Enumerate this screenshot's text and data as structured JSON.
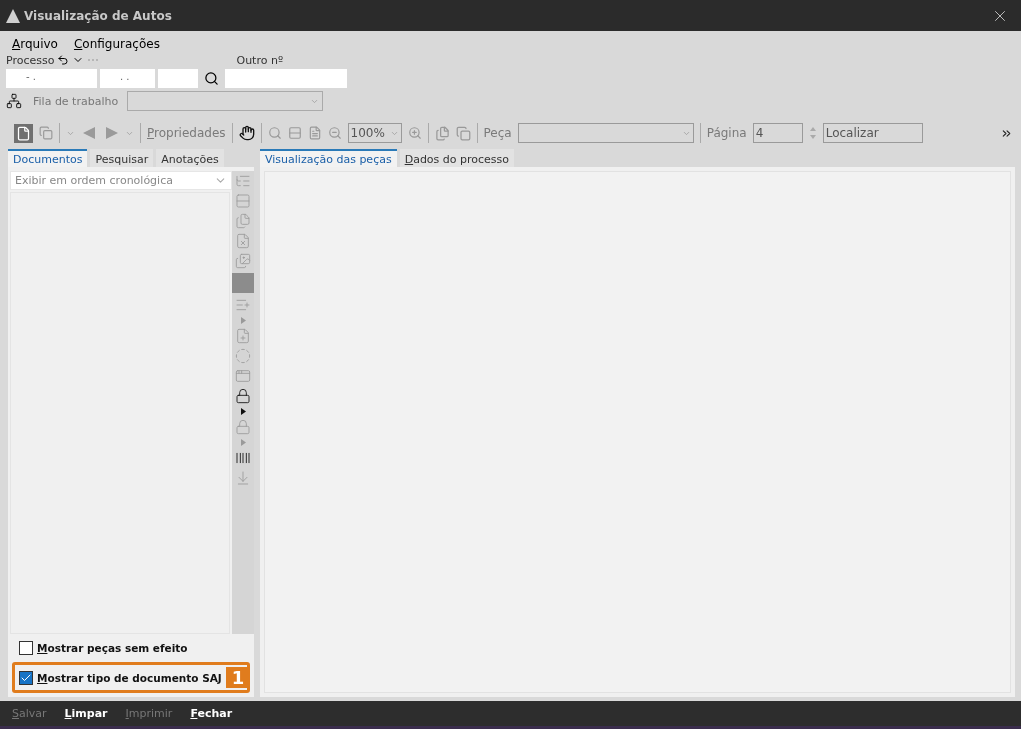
{
  "window": {
    "title": "Visualização de Autos"
  },
  "menu": [
    {
      "label": "Arquivo"
    },
    {
      "label": "Configurações"
    }
  ],
  "processo": {
    "label": "Processo",
    "segments": [
      {
        "kind": "mask",
        "value": "- ."
      },
      {
        "kind": "mask",
        "value": ". ."
      },
      {
        "kind": "blank"
      }
    ],
    "other_label": "Outro nº"
  },
  "fila": {
    "label": "Fila de trabalho",
    "disabled": true
  },
  "toolbar": {
    "properties": "Propriedades",
    "zoom": "100%",
    "peca_label": "Peça",
    "pagina_label": "Página",
    "pagina": "4",
    "localizar": "Localizar"
  },
  "left_tabs": [
    {
      "label": "Documentos",
      "selected": true
    },
    {
      "label": "Pesquisar",
      "selected": false
    },
    {
      "label": "Anotações",
      "selected": false
    }
  ],
  "order": {
    "placeholder": "Exibir em ordem cronológica"
  },
  "side_tools": [
    {
      "kind": "tree",
      "disabled": true
    },
    {
      "kind": "panel",
      "disabled": true
    },
    {
      "kind": "files",
      "disabled": true
    },
    {
      "kind": "filex",
      "disabled": true
    },
    {
      "kind": "images",
      "disabled": true
    },
    {
      "kind": "block",
      "disabled": true
    },
    {
      "kind": "list",
      "disabled": true
    },
    {
      "kind": "arrow",
      "disabled": true
    },
    {
      "kind": "note",
      "disabled": true
    },
    {
      "kind": "dashed",
      "disabled": true
    },
    {
      "kind": "window",
      "disabled": true
    },
    {
      "kind": "lock",
      "disabled": false
    },
    {
      "kind": "arrow",
      "disabled": false
    },
    {
      "kind": "lock",
      "disabled": true
    },
    {
      "kind": "arrow",
      "disabled": true
    },
    {
      "kind": "barcode",
      "disabled": false
    },
    {
      "kind": "download",
      "disabled": true
    }
  ],
  "checkboxes": [
    {
      "label": "Mostrar peças sem efeito",
      "checked": false
    },
    {
      "label": "Mostrar tipo de documento SAJ",
      "checked": true,
      "callout": "1"
    }
  ],
  "right_tabs": [
    {
      "label": "Visualização das peças",
      "selected": true
    },
    {
      "label": "Dados do processo",
      "selected": false
    }
  ],
  "footer": [
    {
      "label": "Salvar",
      "disabled": true
    },
    {
      "label": "Limpar",
      "disabled": false
    },
    {
      "label": "Imprimir",
      "disabled": true
    },
    {
      "label": "Fechar",
      "disabled": false
    }
  ]
}
